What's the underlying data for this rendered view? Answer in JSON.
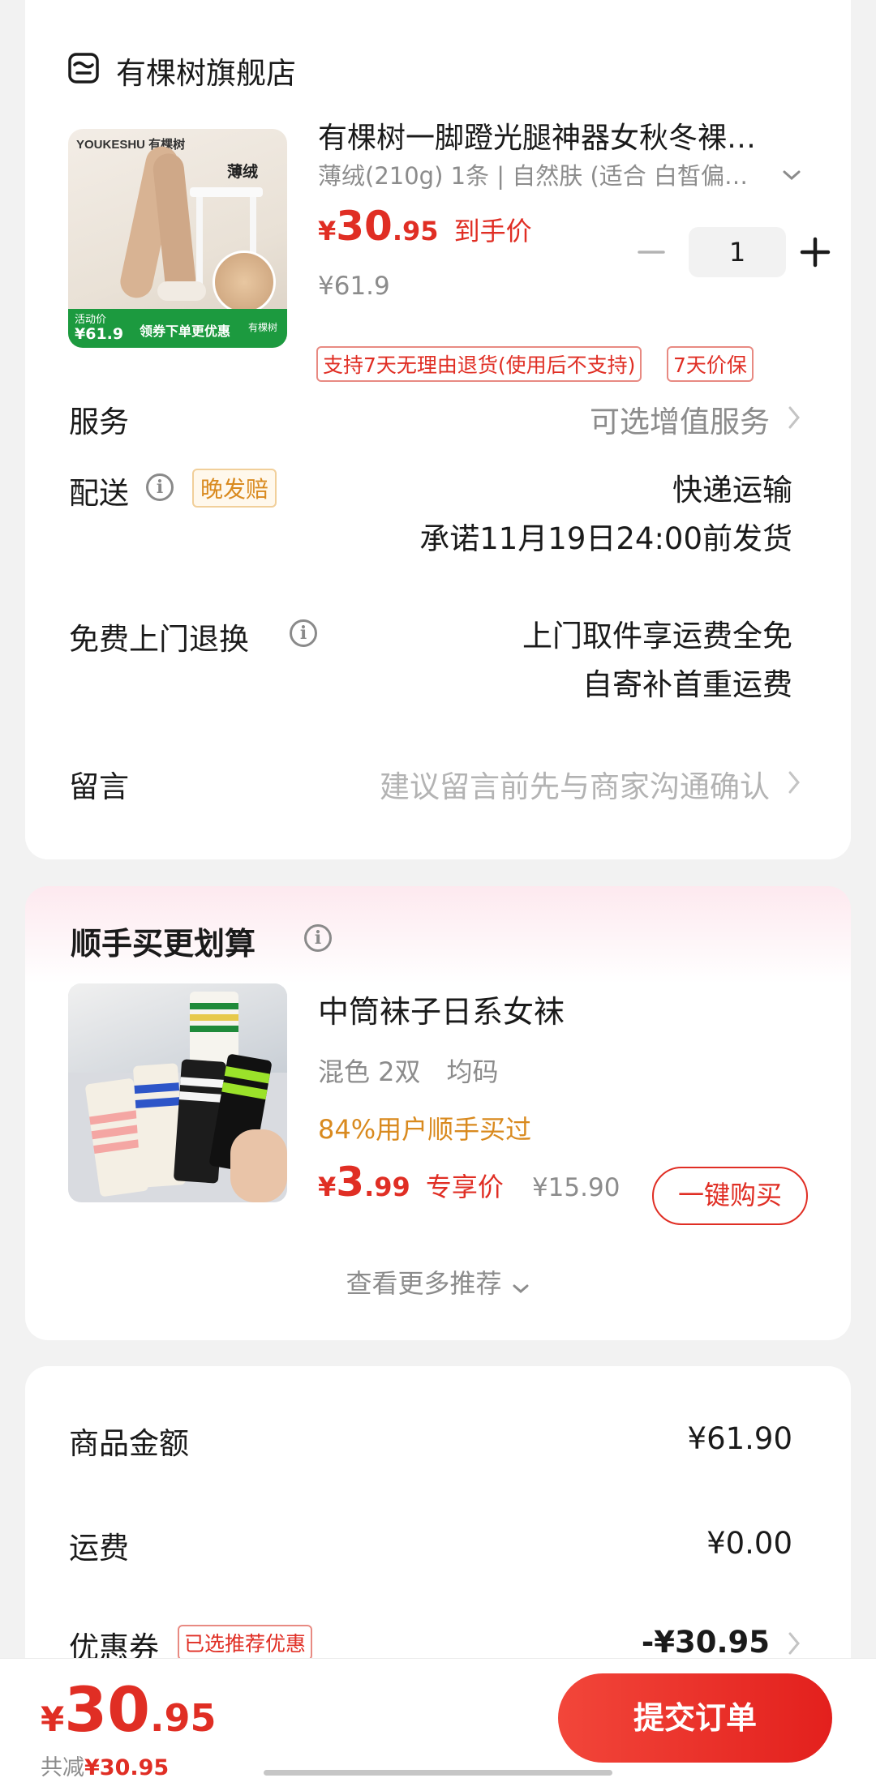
{
  "store": {
    "name": "有棵树旗舰店",
    "icon": "store-icon"
  },
  "product": {
    "title": "有棵树一脚蹬光腿神器女秋冬裸…",
    "spec": "薄绒(210g) 1条 | 自然肤 (适合 白皙偏…",
    "price_symbol": "¥",
    "price_int": "30",
    "price_dec": ".95",
    "price_label": "到手价",
    "original_price": "¥61.9",
    "quantity": "1",
    "tags": [
      "支持7天无理由退货(使用后不支持)",
      "7天价保"
    ],
    "image": {
      "brand": "YOUKESHU 有棵树",
      "badge": "薄绒",
      "promo_label": "活动价",
      "promo_price": "¥61.9",
      "promo_text": "领券下单更优惠",
      "promo_brand": "有棵树"
    }
  },
  "service": {
    "label": "服务",
    "value": "可选增值服务"
  },
  "delivery": {
    "label": "配送",
    "badge": "晚发赔",
    "method": "快递运输",
    "promise": "承诺11月19日24:00前发货"
  },
  "free_return": {
    "label": "免费上门退换",
    "line1": "上门取件享运费全免",
    "line2": "自寄补首重运费"
  },
  "message": {
    "label": "留言",
    "placeholder": "建议留言前先与商家沟通确认"
  },
  "addon": {
    "section_title": "顺手买更划算",
    "title": "中筒袜子日系女袜",
    "spec": "混色 2双　均码",
    "stat": "84%用户顺手买过",
    "price_symbol": "¥",
    "price_int": "3",
    "price_dec": ".99",
    "price_label": "专享价",
    "original_price": "¥15.90",
    "buy_button": "一键购买",
    "more": "查看更多推荐"
  },
  "summary": {
    "goods_label": "商品金额",
    "goods_value": "¥61.90",
    "shipping_label": "运费",
    "shipping_value": "¥0.00",
    "coupon_label": "优惠券",
    "coupon_tag": "已选推荐优惠",
    "coupon_value": "-¥30.95"
  },
  "footer": {
    "price_symbol": "¥",
    "price_int": "30",
    "price_dec": ".95",
    "saved_label": "共减",
    "saved_value": "¥30.95",
    "submit": "提交订单"
  },
  "colors": {
    "accent": "#e02e24",
    "orange": "#d98a1f",
    "background": "#f2f2f2"
  }
}
